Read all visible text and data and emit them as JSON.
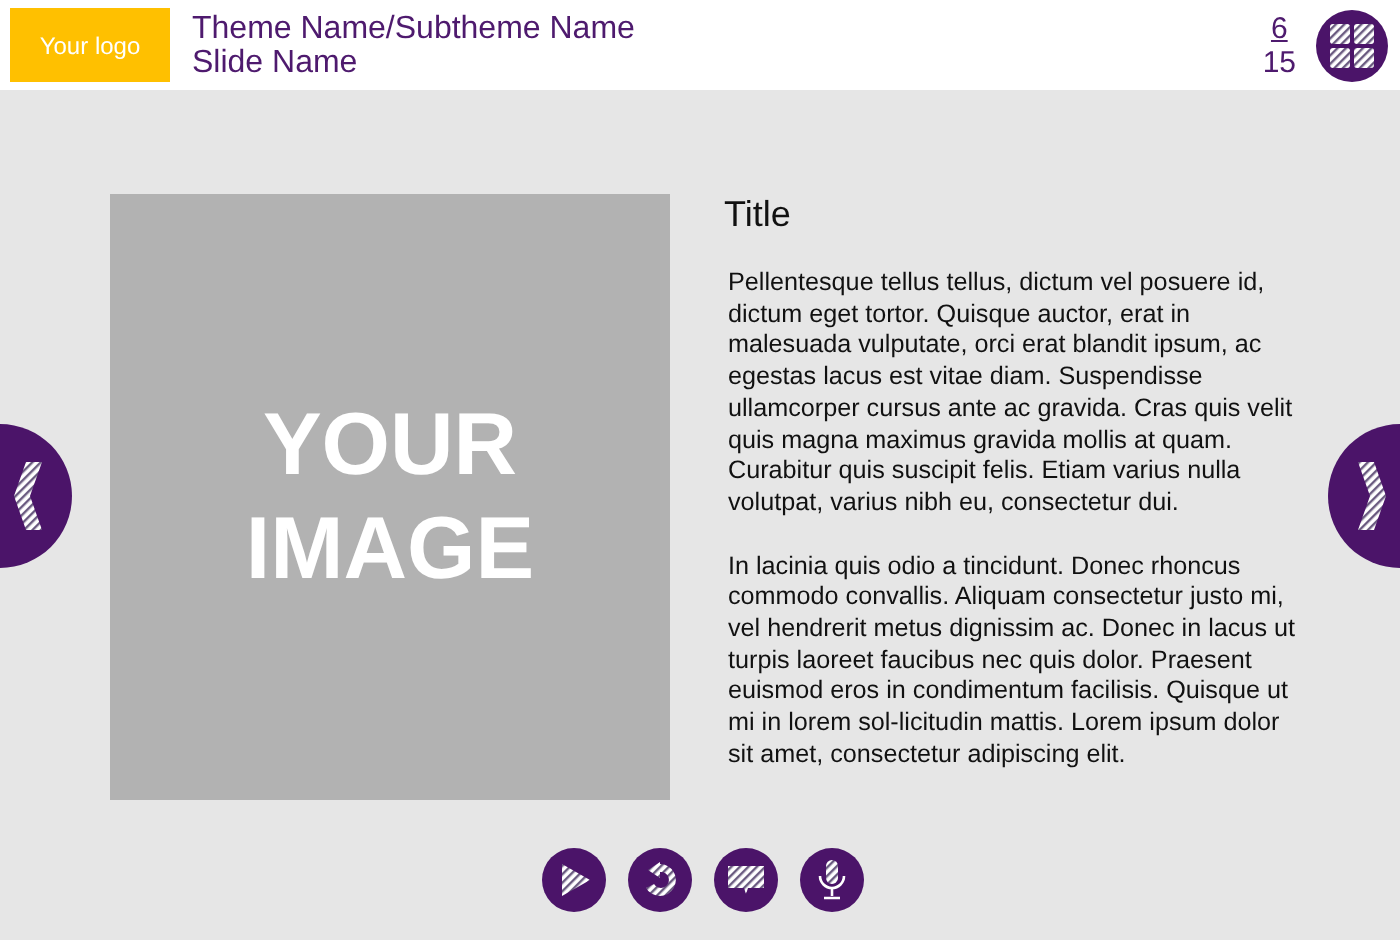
{
  "header": {
    "logo": "Your logo",
    "theme": "Theme Name/Subtheme Name",
    "slide": "Slide Name",
    "page": "6",
    "total": "15"
  },
  "image": {
    "label": "YOUR IMAGE"
  },
  "content": {
    "title": "Title",
    "paragraphs": [
      "Pellentesque tellus tellus, dictum vel posuere id, dictum eget tortor. Quisque auctor, erat in malesuada vulputate, orci erat blandit ipsum, ac egestas lacus est vitae diam. Suspendisse ullamcorper cursus ante ac gravida. Cras quis velit quis magna maximus gravida mollis at quam. Curabitur quis suscipit felis. Etiam varius nulla volutpat, varius nibh eu, consectetur dui.",
      "In lacinia quis odio a tincidunt. Donec rhoncus commodo convallis. Aliquam consectetur justo mi, vel hendrerit metus dignissim ac. Donec in lacus ut turpis laoreet faucibus nec quis dolor. Praesent euismod eros in condimentum facilisis. Quisque ut mi in lorem sol-licitudin mattis. Lorem ipsum dolor sit amet, consectetur adipiscing elit."
    ]
  },
  "controls": [
    {
      "kind": "play"
    },
    {
      "kind": "replay"
    },
    {
      "kind": "captions"
    },
    {
      "kind": "voice"
    }
  ]
}
